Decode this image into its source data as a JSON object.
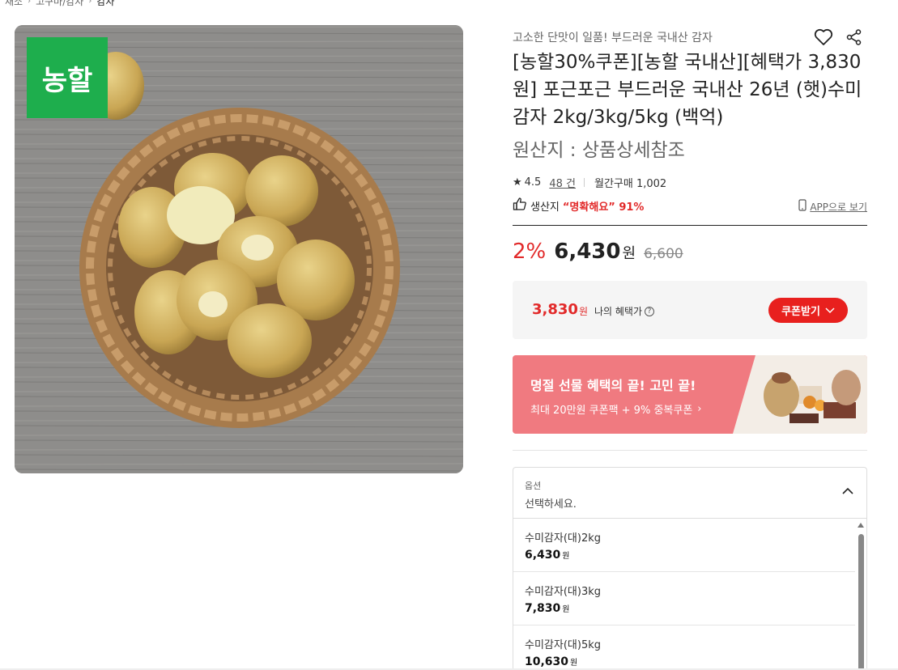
{
  "breadcrumb": [
    "채소",
    "고구마/감자",
    "감자"
  ],
  "image": {
    "brand_logo_text": "농할"
  },
  "product": {
    "subtitle": "고소한 단맛이 일품! 부드러운 국내산 감자",
    "title": "[농할30%쿠폰][농할 국내산][혜택가 3,830원] 포근포근 부드러운 국내산 26년 (햇)수미감자 2kg/3kg/5kg (백억)",
    "origin": "원산지 : 상품상세참조",
    "rating": "4.5",
    "reviews": "48 건",
    "monthly_sales": "월간구매 1,002",
    "freshness_label": "생산지",
    "freshness_value": "“명확해요” 91%",
    "app_view": "APP으로 보기",
    "discount": "2%",
    "price": "6,430",
    "price_unit": "원",
    "original_price": "6,600"
  },
  "benefit": {
    "price": "3,830",
    "unit": "원",
    "label": "나의 혜택가",
    "help": "?",
    "coupon_button": "쿠폰받기"
  },
  "banner": {
    "title": "명절 선물 혜택의 끝! 고민 끝!",
    "subtitle": "최대 20만원 쿠폰팩 + 9% 중복쿠폰"
  },
  "options": {
    "label": "옵션",
    "placeholder": "선택하세요.",
    "items": [
      {
        "name": "수미감자(대)2kg",
        "price": "6,430",
        "unit": "원"
      },
      {
        "name": "수미감자(대)3kg",
        "price": "7,830",
        "unit": "원"
      },
      {
        "name": "수미감자(대)5kg",
        "price": "10,630",
        "unit": "원"
      }
    ]
  },
  "colors": {
    "accent_red": "#e8201e",
    "brand_green": "#1eae4d",
    "banner_pink": "#f07a80"
  },
  "icons": [
    "heart-icon",
    "share-icon",
    "star-icon",
    "thumbs-up-icon",
    "phone-icon",
    "chevron-down-icon",
    "chevron-up-icon",
    "chevron-right-icon"
  ]
}
